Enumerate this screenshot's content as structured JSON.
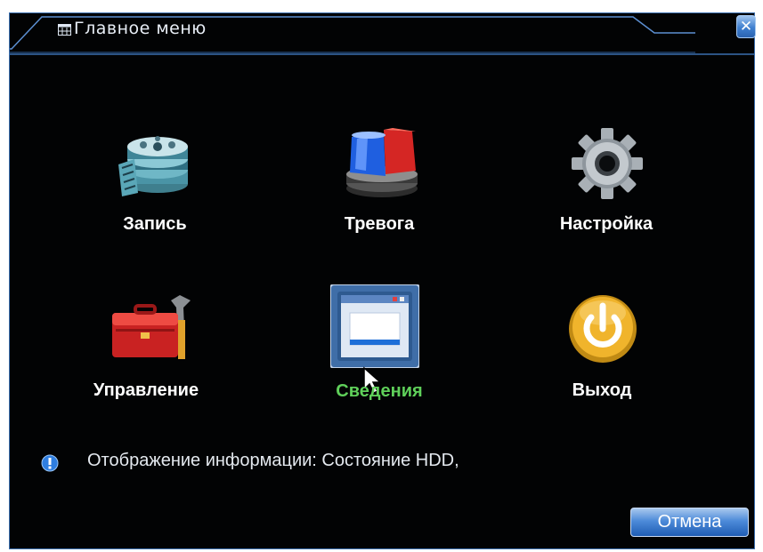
{
  "window": {
    "title": "Главное меню",
    "close_symbol": "✕"
  },
  "menu": {
    "items": [
      {
        "label": "Запись",
        "icon": "film-reel-icon"
      },
      {
        "label": "Тревога",
        "icon": "alarm-siren-icon"
      },
      {
        "label": "Настройка",
        "icon": "gear-icon"
      },
      {
        "label": "Управление",
        "icon": "toolbox-icon"
      },
      {
        "label": "Сведения",
        "icon": "info-window-icon",
        "selected": true
      },
      {
        "label": "Выход",
        "icon": "power-icon"
      }
    ]
  },
  "info": {
    "text": "Отображение информации: Состояние HDD,",
    "icon": "info-icon"
  },
  "buttons": {
    "cancel": "Отмена"
  },
  "colors": {
    "background": "#020304",
    "frame": "#3b6fb0",
    "selected_label": "#5fd05a",
    "label": "#ffffff"
  }
}
